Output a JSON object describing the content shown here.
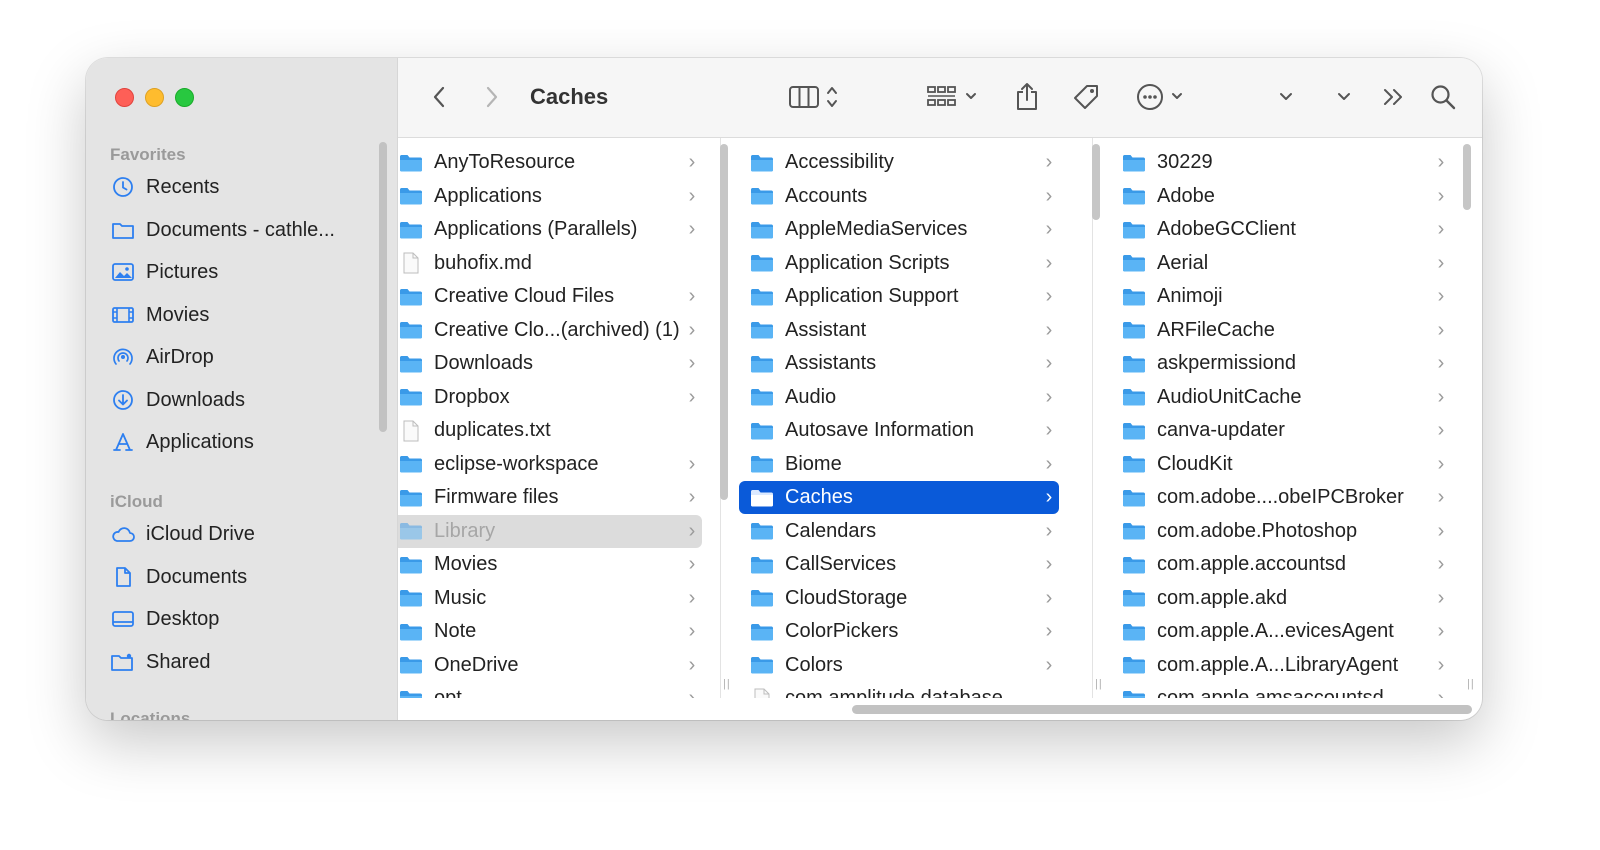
{
  "window": {
    "title": "Caches",
    "traffic_lights": {
      "close": "#fe5f57",
      "minimize": "#febc2e",
      "zoom": "#28c840"
    }
  },
  "toolbar": {
    "back_icon": "chevron-left-icon",
    "forward_icon": "chevron-right-icon",
    "view_icon": "column-view-icon",
    "group_icon": "grid-icon",
    "share_icon": "share-icon",
    "tag_icon": "tag-icon",
    "action_icon": "ellipsis-circle-icon",
    "more_icon": "double-chevron-icon",
    "search_icon": "search-icon"
  },
  "sidebar": {
    "favorites_header": "Favorites",
    "favorites": [
      {
        "label": "Recents",
        "icon": "clock-icon"
      },
      {
        "label": "Documents - cathle...",
        "icon": "folder-icon"
      },
      {
        "label": "Pictures",
        "icon": "photo-icon"
      },
      {
        "label": "Movies",
        "icon": "film-icon"
      },
      {
        "label": "AirDrop",
        "icon": "airdrop-icon"
      },
      {
        "label": "Downloads",
        "icon": "download-icon"
      },
      {
        "label": "Applications",
        "icon": "applications-icon"
      }
    ],
    "icloud_header": "iCloud",
    "icloud": [
      {
        "label": "iCloud Drive",
        "icon": "cloud-icon"
      },
      {
        "label": "Documents",
        "icon": "document-icon"
      },
      {
        "label": "Desktop",
        "icon": "desktop-icon"
      },
      {
        "label": "Shared",
        "icon": "shared-folder-icon"
      }
    ],
    "locations_header": "Locations"
  },
  "columns": {
    "col1": [
      {
        "name": "AnyToResource",
        "kind": "folder"
      },
      {
        "name": "Applications",
        "kind": "folder"
      },
      {
        "name": "Applications (Parallels)",
        "kind": "folder"
      },
      {
        "name": "buhofix.md",
        "kind": "file"
      },
      {
        "name": "Creative Cloud Files",
        "kind": "folder"
      },
      {
        "name": "Creative Clo...(archived) (1)",
        "kind": "folder"
      },
      {
        "name": "Downloads",
        "kind": "folder"
      },
      {
        "name": "Dropbox",
        "kind": "folder"
      },
      {
        "name": "duplicates.txt",
        "kind": "file"
      },
      {
        "name": "eclipse-workspace",
        "kind": "folder"
      },
      {
        "name": "Firmware files",
        "kind": "folder"
      },
      {
        "name": "Library",
        "kind": "folder"
      },
      {
        "name": "Movies",
        "kind": "folder"
      },
      {
        "name": "Music",
        "kind": "folder"
      },
      {
        "name": "Note",
        "kind": "folder"
      },
      {
        "name": "OneDrive",
        "kind": "folder"
      },
      {
        "name": "opt",
        "kind": "folder"
      }
    ],
    "col2": [
      {
        "name": "Accessibility",
        "kind": "folder"
      },
      {
        "name": "Accounts",
        "kind": "folder"
      },
      {
        "name": "AppleMediaServices",
        "kind": "folder"
      },
      {
        "name": "Application Scripts",
        "kind": "folder"
      },
      {
        "name": "Application Support",
        "kind": "folder"
      },
      {
        "name": "Assistant",
        "kind": "folder"
      },
      {
        "name": "Assistants",
        "kind": "folder"
      },
      {
        "name": "Audio",
        "kind": "folder"
      },
      {
        "name": "Autosave Information",
        "kind": "folder"
      },
      {
        "name": "Biome",
        "kind": "folder"
      },
      {
        "name": "Caches",
        "kind": "folder"
      },
      {
        "name": "Calendars",
        "kind": "folder"
      },
      {
        "name": "CallServices",
        "kind": "folder"
      },
      {
        "name": "CloudStorage",
        "kind": "folder"
      },
      {
        "name": "ColorPickers",
        "kind": "folder"
      },
      {
        "name": "Colors",
        "kind": "folder"
      },
      {
        "name": "com.amplitude.database",
        "kind": "file"
      }
    ],
    "col3": [
      {
        "name": "30229",
        "kind": "folder"
      },
      {
        "name": "Adobe",
        "kind": "folder"
      },
      {
        "name": "AdobeGCClient",
        "kind": "folder"
      },
      {
        "name": "Aerial",
        "kind": "folder"
      },
      {
        "name": "Animoji",
        "kind": "folder"
      },
      {
        "name": "ARFileCache",
        "kind": "folder"
      },
      {
        "name": "askpermissiond",
        "kind": "folder"
      },
      {
        "name": "AudioUnitCache",
        "kind": "folder"
      },
      {
        "name": "canva-updater",
        "kind": "folder"
      },
      {
        "name": "CloudKit",
        "kind": "folder"
      },
      {
        "name": "com.adobe....obeIPCBroker",
        "kind": "folder"
      },
      {
        "name": "com.adobe.Photoshop",
        "kind": "folder"
      },
      {
        "name": "com.apple.accountsd",
        "kind": "folder"
      },
      {
        "name": "com.apple.akd",
        "kind": "folder"
      },
      {
        "name": "com.apple.A...evicesAgent",
        "kind": "folder"
      },
      {
        "name": "com.apple.A...LibraryAgent",
        "kind": "folder"
      },
      {
        "name": "com.apple.amsaccountsd",
        "kind": "folder"
      }
    ],
    "chevron": "›",
    "selected_col2": "Caches",
    "highlighted_col1": "Library",
    "colors": {
      "selection": "#0a5ad9",
      "folder": "#5ab4f5",
      "folder_tab": "#3a9ae8"
    }
  }
}
